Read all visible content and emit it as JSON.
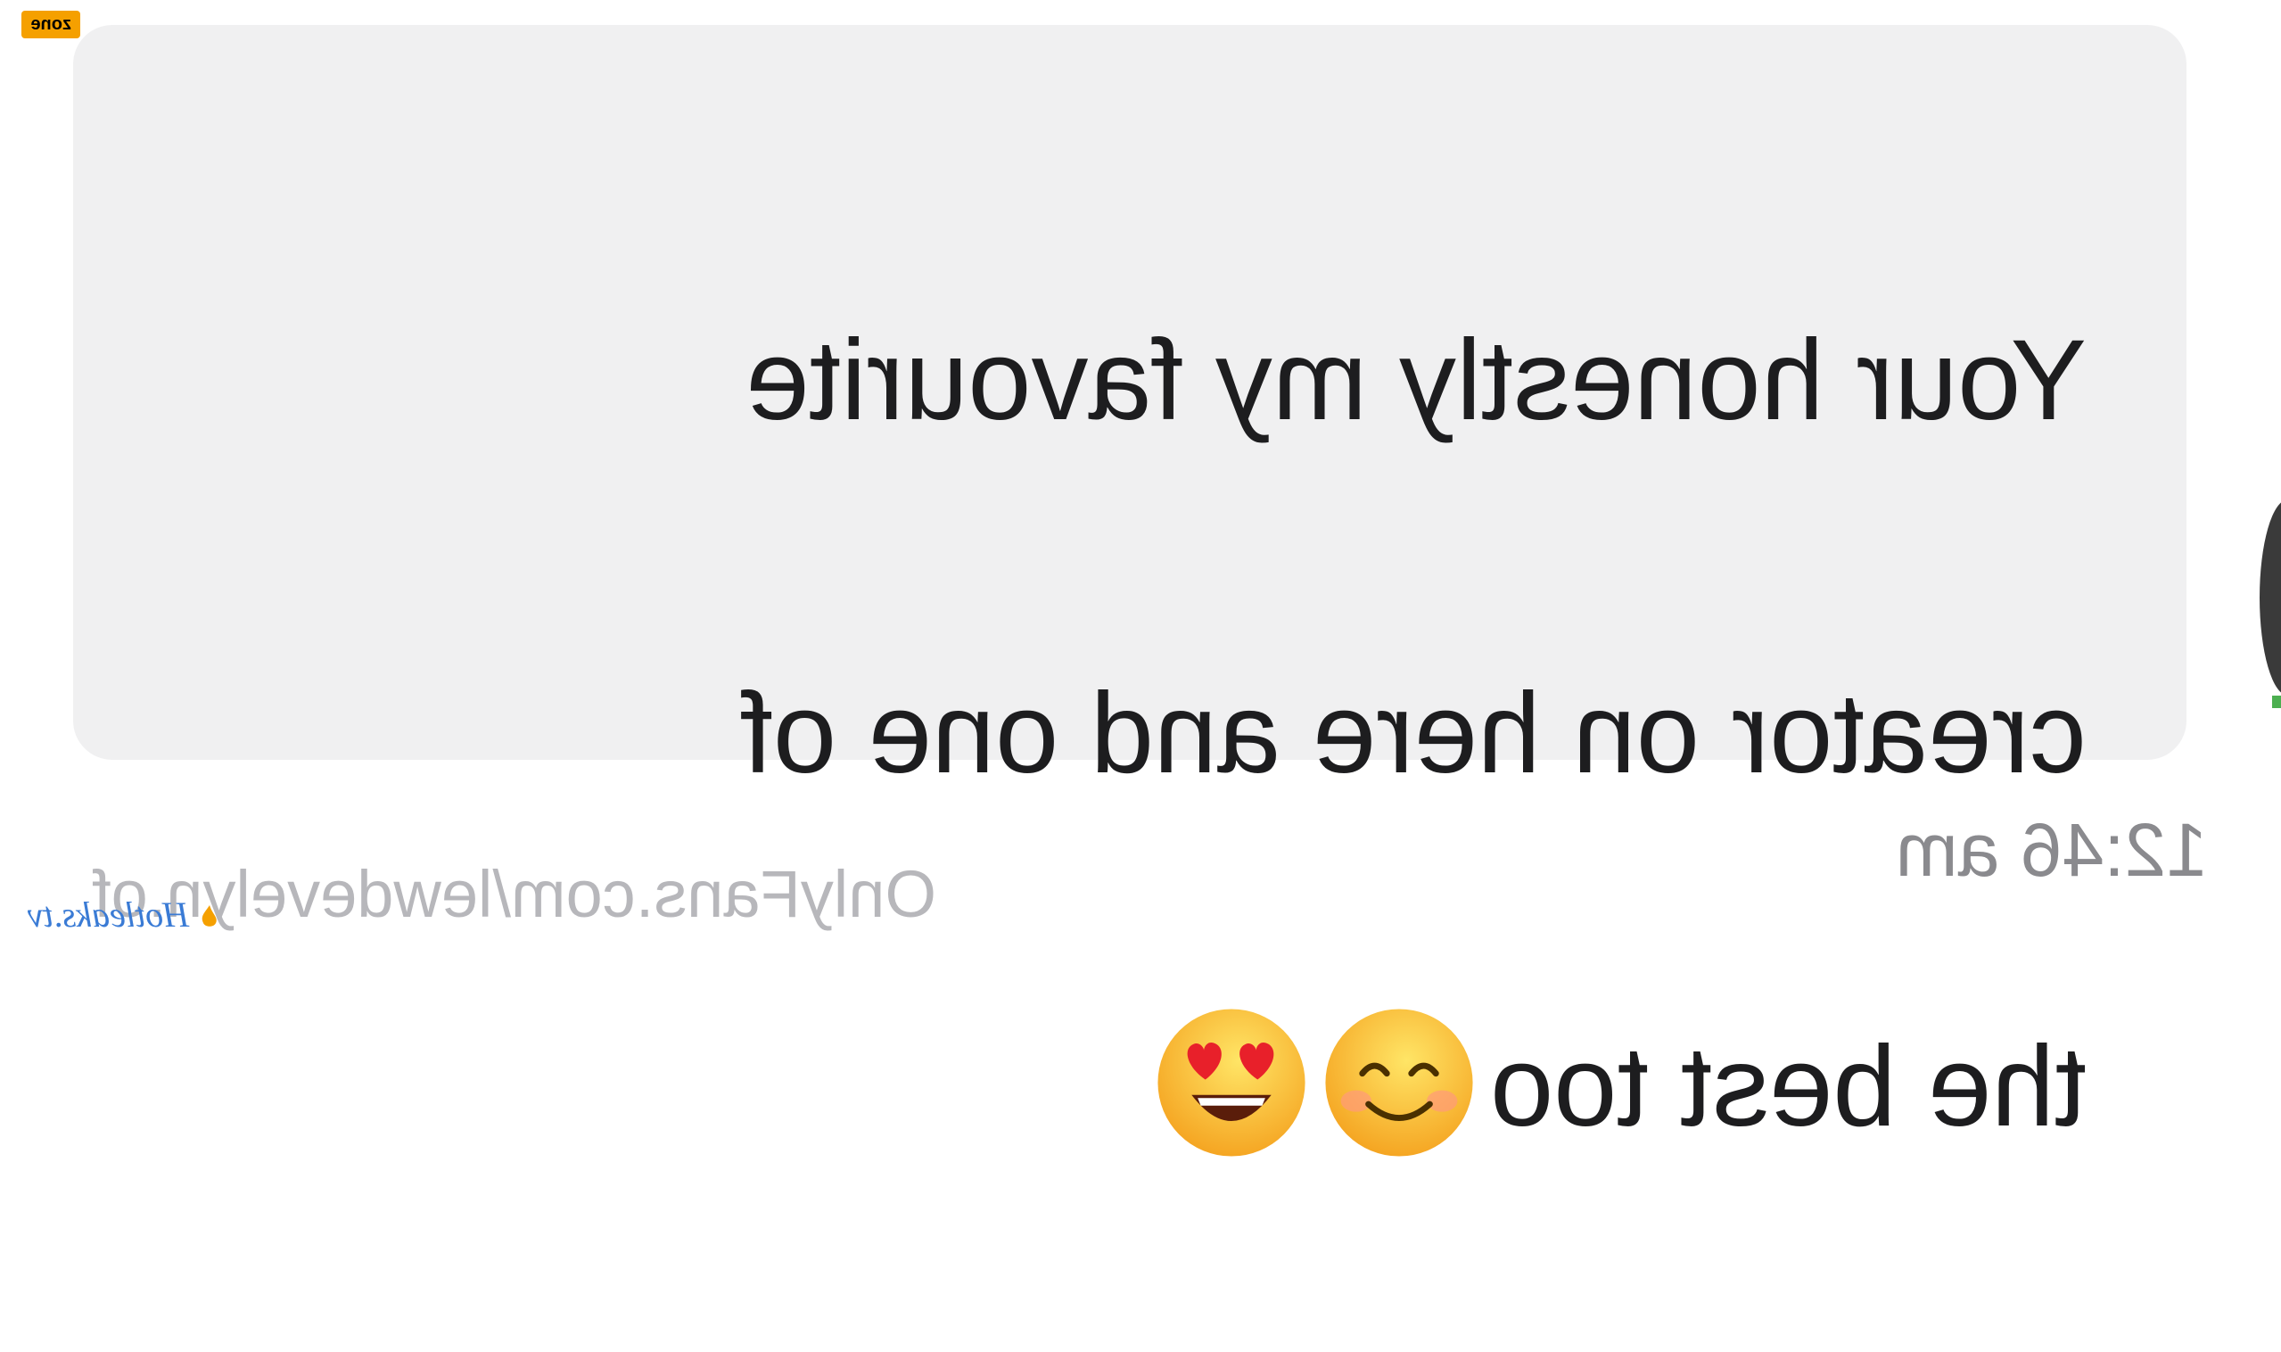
{
  "message": {
    "lines": [
      "Your honestly my favourite",
      "creator on here and one of",
      "the best too"
    ],
    "emojis": [
      "heart-eyes-emoji",
      "smiling-face-emoji"
    ]
  },
  "timestamp": "12:46 am",
  "watermark": {
    "url": "OnlyFans.com/lewdevelyn.of",
    "badge": "zone",
    "logo": "Hotleaks.tv"
  },
  "colors": {
    "bubble": "#f0f0f1",
    "text": "#1d1d1f",
    "timestamp": "#8a8a8e",
    "watermark": "#b7b7bb",
    "badge": "#f5a000",
    "logo": "#3a7bd5"
  }
}
